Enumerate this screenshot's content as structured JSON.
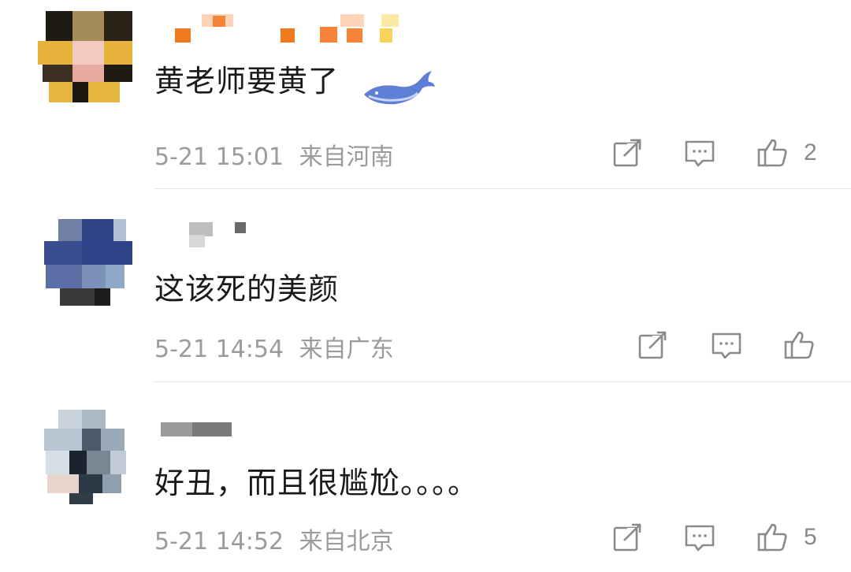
{
  "comments": [
    {
      "text": "黄老师要黄了",
      "time": "5-21 15:01",
      "location": "来自河南",
      "like_count": "2"
    },
    {
      "text": "这该死的美颜",
      "time": "5-21 14:54",
      "location": "来自广东",
      "like_count": ""
    },
    {
      "text": "好丑，而且很尴尬。。。。",
      "time": "5-21 14:52",
      "location": "来自北京",
      "like_count": "5"
    }
  ],
  "icons": {
    "share": "share-icon",
    "reply": "comment-icon",
    "like": "thumbs-up-icon",
    "badge": "whale-icon"
  },
  "colors": {
    "text": "#1a1a1a",
    "meta": "#9b9b9b",
    "icon": "#8a8a8a",
    "divider": "#e6e6e6"
  }
}
